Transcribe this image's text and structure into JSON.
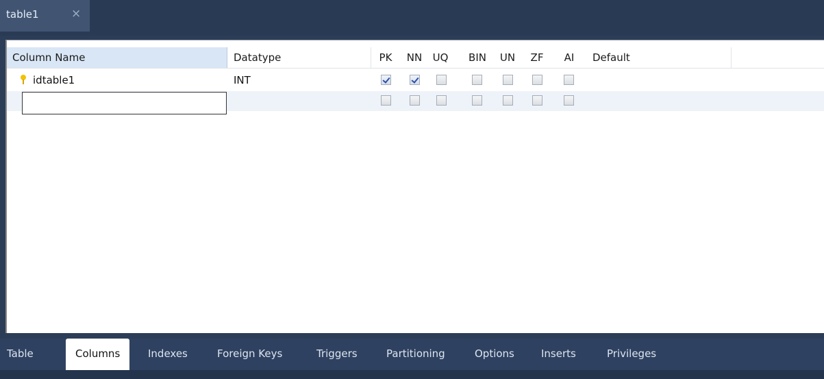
{
  "document_tab": {
    "title": "table1",
    "close_glyph": "×"
  },
  "grid": {
    "headers": {
      "column_name": "Column Name",
      "datatype": "Datatype",
      "pk": "PK",
      "nn": "NN",
      "uq": "UQ",
      "bin": "BIN",
      "un": "UN",
      "zf": "ZF",
      "ai": "AI",
      "default": "Default"
    },
    "rows": [
      {
        "name": "idtable1",
        "datatype": "INT",
        "icon": "primary-key-icon",
        "flags": {
          "pk": true,
          "nn": true,
          "uq": false,
          "bin": false,
          "un": false,
          "zf": false,
          "ai": false
        },
        "default": ""
      },
      {
        "name": "",
        "datatype": "",
        "flags": {
          "pk": false,
          "nn": false,
          "uq": false,
          "bin": false,
          "un": false,
          "zf": false,
          "ai": false
        },
        "default": "",
        "editing": true
      }
    ]
  },
  "bottom_tabs": [
    {
      "label": "Table",
      "active": false
    },
    {
      "label": "Columns",
      "active": true
    },
    {
      "label": "Indexes",
      "active": false
    },
    {
      "label": "Foreign Keys",
      "active": false
    },
    {
      "label": "Triggers",
      "active": false
    },
    {
      "label": "Partitioning",
      "active": false
    },
    {
      "label": "Options",
      "active": false
    },
    {
      "label": "Inserts",
      "active": false
    },
    {
      "label": "Privileges",
      "active": false
    }
  ],
  "colors": {
    "header_selected": "#d9e6f5",
    "check": "#2c4fa8",
    "chrome": "#2c3d57"
  }
}
